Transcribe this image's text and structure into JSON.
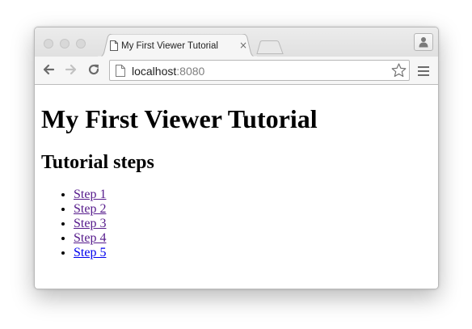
{
  "browser": {
    "tab": {
      "title": "My First Viewer Tutorial",
      "close": "×"
    },
    "address_bar": {
      "host": "localhost",
      "port": ":8080"
    },
    "icons": {
      "back": "back-arrow-icon",
      "forward": "forward-arrow-icon",
      "reload": "reload-icon",
      "page": "page-icon",
      "bookmark": "star-icon",
      "menu": "hamburger-menu-icon",
      "profile": "person-icon",
      "favicon": "document-icon"
    }
  },
  "page": {
    "title": "My First Viewer Tutorial",
    "subtitle": "Tutorial steps",
    "steps": [
      {
        "label": "Step 1",
        "visited": true
      },
      {
        "label": "Step 2",
        "visited": true
      },
      {
        "label": "Step 3",
        "visited": true
      },
      {
        "label": "Step 4",
        "visited": true
      },
      {
        "label": "Step 5",
        "visited": false
      }
    ]
  },
  "colors": {
    "visited_link": "#551a8b",
    "unvisited_link": "#0000ee",
    "port_text": "#7f7f7f"
  }
}
